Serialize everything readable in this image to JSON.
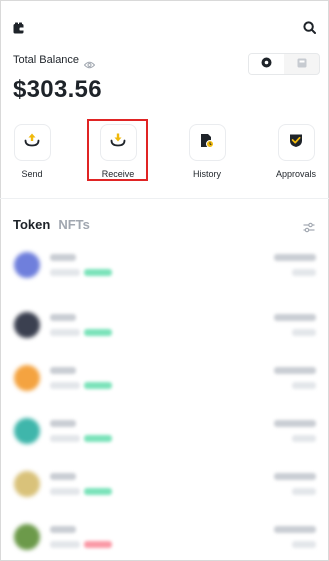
{
  "header": {
    "left_icon": "wallet-icon",
    "right_icon": "search-icon"
  },
  "balance": {
    "label": "Total Balance",
    "value": "$303.56",
    "visibility_icon": "eye-icon"
  },
  "view_toggle": {
    "options": [
      {
        "icon": "token-view-icon",
        "active": true
      },
      {
        "icon": "card-view-icon",
        "active": false
      }
    ]
  },
  "actions": [
    {
      "label": "Send",
      "icon": "send-icon"
    },
    {
      "label": "Receive",
      "icon": "receive-icon",
      "highlighted": true
    },
    {
      "label": "History",
      "icon": "history-icon"
    },
    {
      "label": "Approvals",
      "icon": "approvals-icon"
    }
  ],
  "tabs": [
    {
      "label": "Token",
      "active": true
    },
    {
      "label": "NFTs",
      "active": false
    }
  ],
  "colors": {
    "accent": "#f0b90b",
    "text_primary": "#1e2329",
    "text_muted": "#a1a7b0",
    "highlight_red": "#e02424",
    "change_green": "#0ecb81",
    "change_red": "#f6465d"
  },
  "tokens": [
    {
      "logo_color": "#6f7fdc",
      "change_color": "#0ecb81"
    },
    {
      "logo_color": "#3b4050",
      "change_color": "#0ecb81"
    },
    {
      "logo_color": "#f4a340",
      "change_color": "#0ecb81"
    },
    {
      "logo_color": "#3fb6ab",
      "change_color": "#0ecb81"
    },
    {
      "logo_color": "#d9c27a",
      "change_color": "#0ecb81"
    },
    {
      "logo_color": "#6c9a4a",
      "change_color": "#f6465d"
    }
  ]
}
